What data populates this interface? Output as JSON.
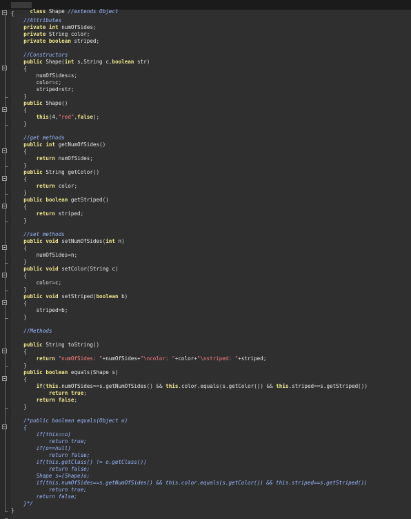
{
  "top": {
    "line_kw": "class",
    "line_name": " Shape ",
    "line_comment": "//extends Object"
  },
  "code_lines": [
    "{",
    "    //Attributes",
    "    private int numOfSides;",
    "    private String color;",
    "    private boolean striped;",
    "",
    "    //Constructors",
    "    public Shape(int s,String c,boolean str)",
    "    {",
    "        numOfSides=s;",
    "        color=c;",
    "        striped=str;",
    "    }",
    "    public Shape()",
    "    {",
    "        this(4,\"red\",false);",
    "    }",
    "",
    "    //get methods",
    "    public int getNumOfSides()",
    "    {",
    "        return numOfSides;",
    "    }",
    "    public String getColor()",
    "    {",
    "        return color;",
    "    }",
    "    public boolean getStriped()",
    "    {",
    "        return striped;",
    "    }",
    "",
    "    //set methods",
    "    public void setNumOfSides(int n)",
    "    {",
    "        numOfSides=n;",
    "    }",
    "    public void setColor(String c)",
    "    {",
    "        color=c;",
    "    }",
    "    public void setStriped(boolean b)",
    "    {",
    "        striped=b;",
    "    }",
    "",
    "    //Methods",
    "",
    "    public String toString()",
    "    {",
    "        return \"numOfSides: \"+numOfSides+\"\\ncolor: \"+color+\"\\nstriped: \"+striped;",
    "    }",
    "    public boolean equals(Shape s)",
    "    {",
    "        if(this.numOfSides==s.getNumOfSides() && this.color.equals(s.getColor()) && this.striped==s.getStriped())",
    "            return true;",
    "        return false;",
    "    }",
    "",
    "    /*public boolean equals(Object o)",
    "    {",
    "        if(this==o)",
    "            return true;",
    "        if(o==null)",
    "            return false;",
    "        if(this.getClass() != o.getClass())",
    "            return false;",
    "        Shape s=(Shape)o;",
    "        if(this.numOfSides==s.getNumOfSides() && this.color.equals(s.getColor()) && this.striped==s.getStriped())",
    "            return true;",
    "        return false;",
    "    }*/",
    "}"
  ],
  "icons": {
    "fold": "fold-minus-icon"
  }
}
